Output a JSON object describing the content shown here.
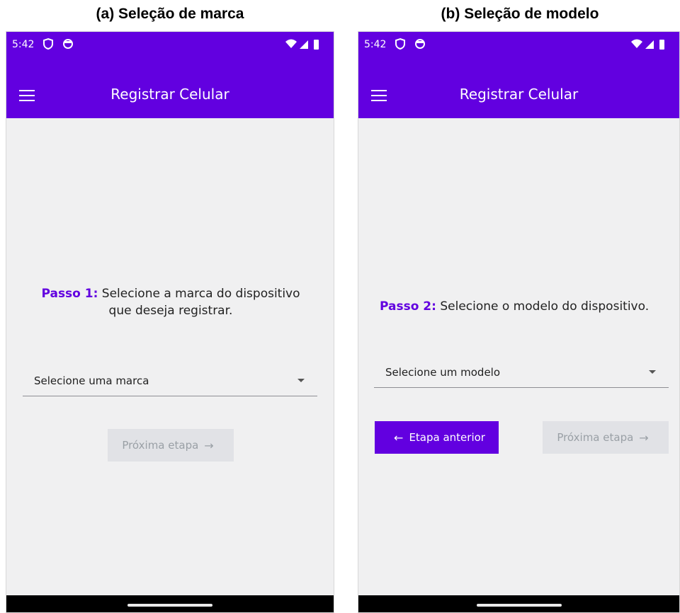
{
  "captions": {
    "a": "(a) Seleção de marca",
    "b": "(b) Seleção de modelo"
  },
  "colors": {
    "accent": "#6200e0",
    "background": "#f0f0f1",
    "disabled_button": "#e1e2e6"
  },
  "screen_a": {
    "status_time": "5:42",
    "status_icons": [
      "shield-icon",
      "circle-icon",
      "wifi-icon",
      "signal-icon",
      "battery-icon"
    ],
    "app_title": "Registrar Celular",
    "step_label": "Passo 1:",
    "step_text_line1": " Selecione a marca do dispositivo",
    "step_text_line2": "que deseja registrar.",
    "select_value": "Selecione uma marca",
    "next_button": "Próxima etapa"
  },
  "screen_b": {
    "status_time": "5:42",
    "status_icons": [
      "shield-icon",
      "circle-icon",
      "wifi-icon",
      "signal-icon",
      "battery-icon"
    ],
    "app_title": "Registrar Celular",
    "step_label": "Passo 2:",
    "step_text": " Selecione o modelo do dispositivo.",
    "select_value": "Selecione um modelo",
    "back_button": "Etapa anterior",
    "next_button": "Próxima etapa"
  }
}
